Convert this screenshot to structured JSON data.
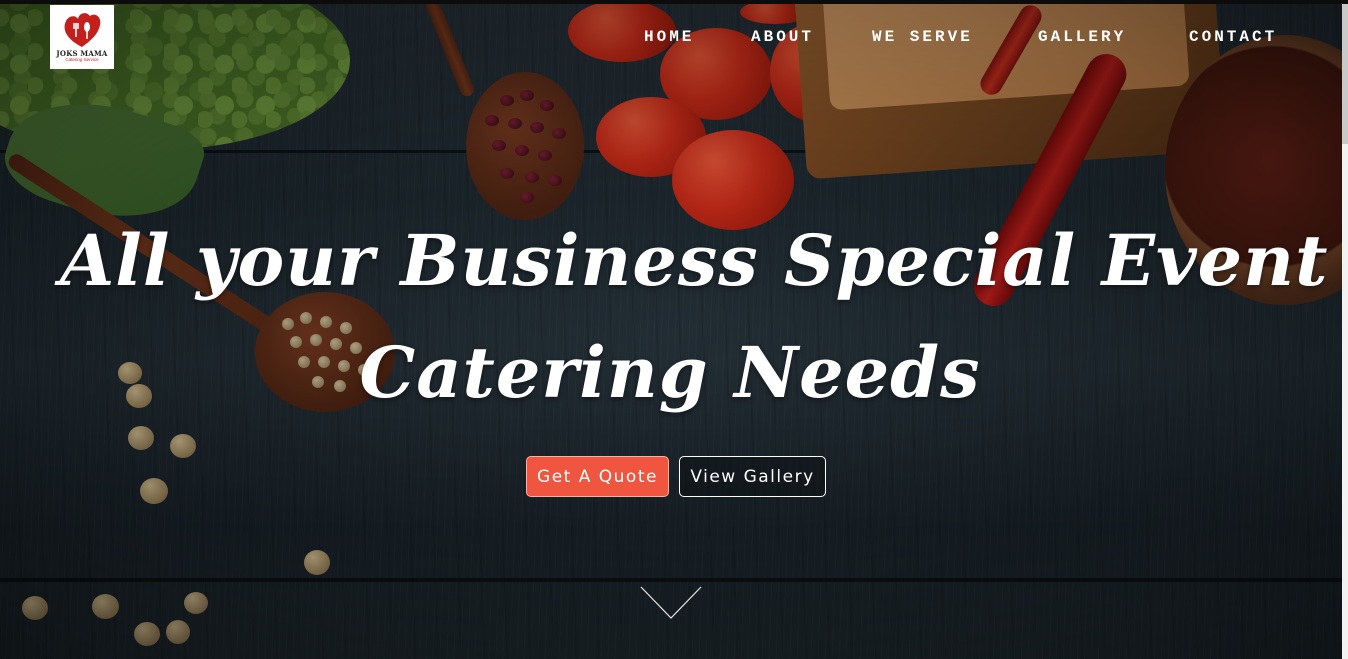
{
  "brand": {
    "logo_text": "JOKS MAMA",
    "logo_subtext": "Catering Service",
    "colors": {
      "accent": "#f0553f",
      "logo_red": "#c3201c"
    }
  },
  "nav": {
    "items": [
      {
        "label": "HOME"
      },
      {
        "label": "ABOUT"
      },
      {
        "label": "WE SERVE"
      },
      {
        "label": "GALLERY"
      },
      {
        "label": "CONTACT"
      }
    ]
  },
  "hero": {
    "title_line1": "All your Business Special Event",
    "title_line2": "Catering Needs",
    "buttons": {
      "quote_label": "Get A Quote",
      "gallery_label": "View Gallery"
    },
    "scroll_icon": "chevron-down-icon"
  }
}
